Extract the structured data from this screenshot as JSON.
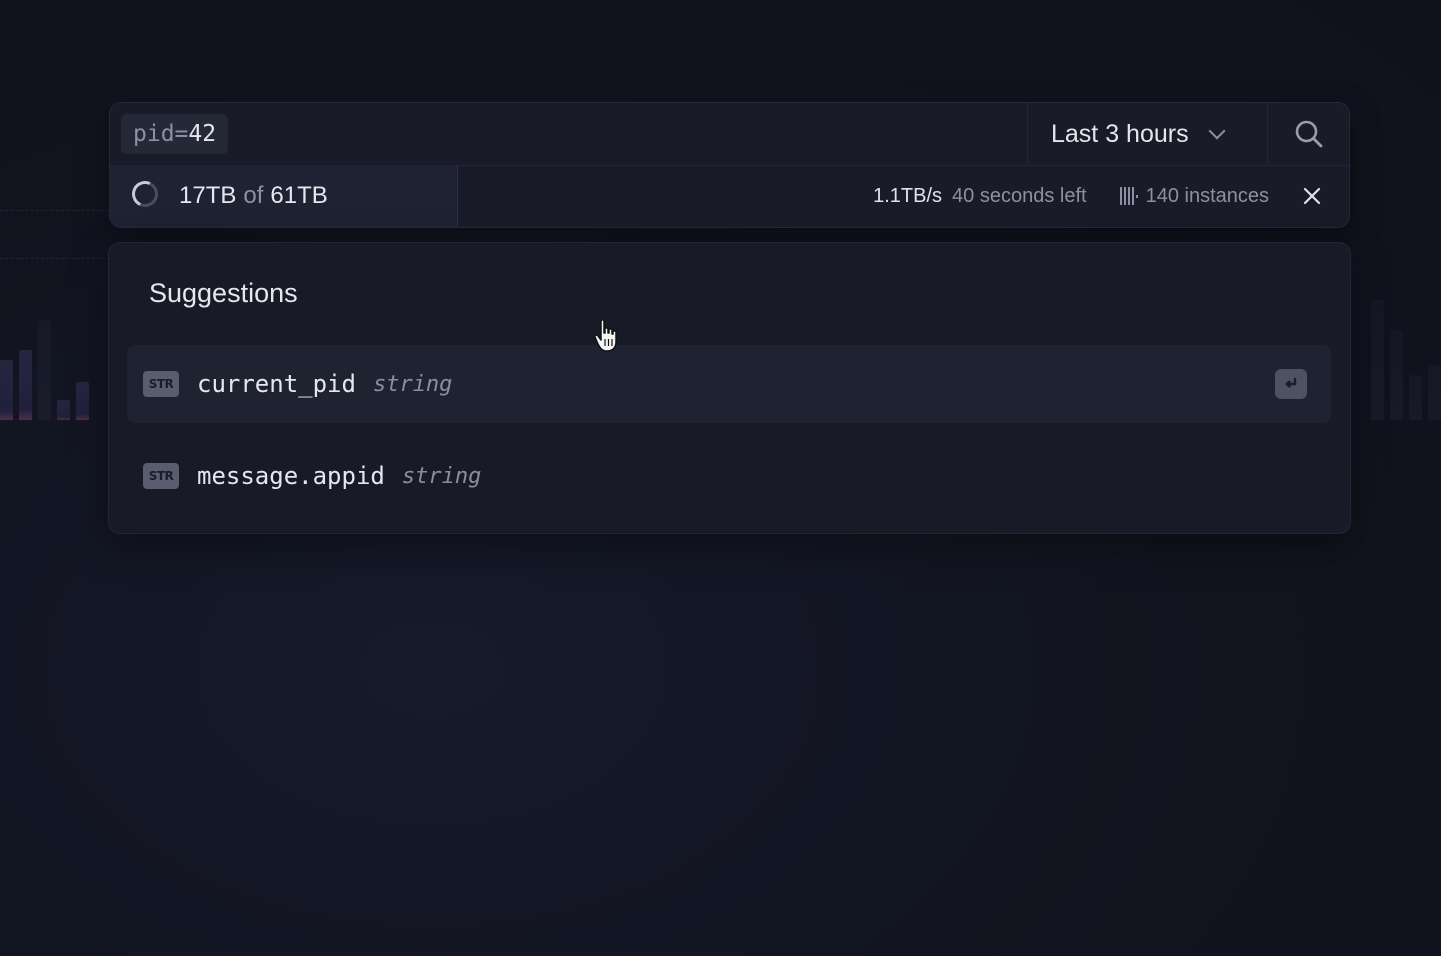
{
  "search": {
    "query_key": "pid",
    "query_operator": "=",
    "query_value": "42",
    "time_range": "Last 3 hours",
    "search_icon": "search-icon"
  },
  "progress": {
    "scanned": "17TB",
    "of_label": "of",
    "total": "61TB",
    "fraction": 0.28,
    "rate": "1.1TB/s",
    "eta": "40 seconds left",
    "instances": "140 instances",
    "close_icon": "close-icon"
  },
  "suggestions": {
    "title": "Suggestions",
    "items": [
      {
        "badge": "STR",
        "name": "current_pid",
        "type": "string",
        "active": true
      },
      {
        "badge": "STR",
        "name": "message.appid",
        "type": "string",
        "active": false
      }
    ]
  },
  "colors": {
    "background": "#11131f",
    "panel": "#191b28",
    "text_primary": "#e6e7ee",
    "text_muted": "#8d90a2",
    "badge": "#5a5d6e"
  }
}
